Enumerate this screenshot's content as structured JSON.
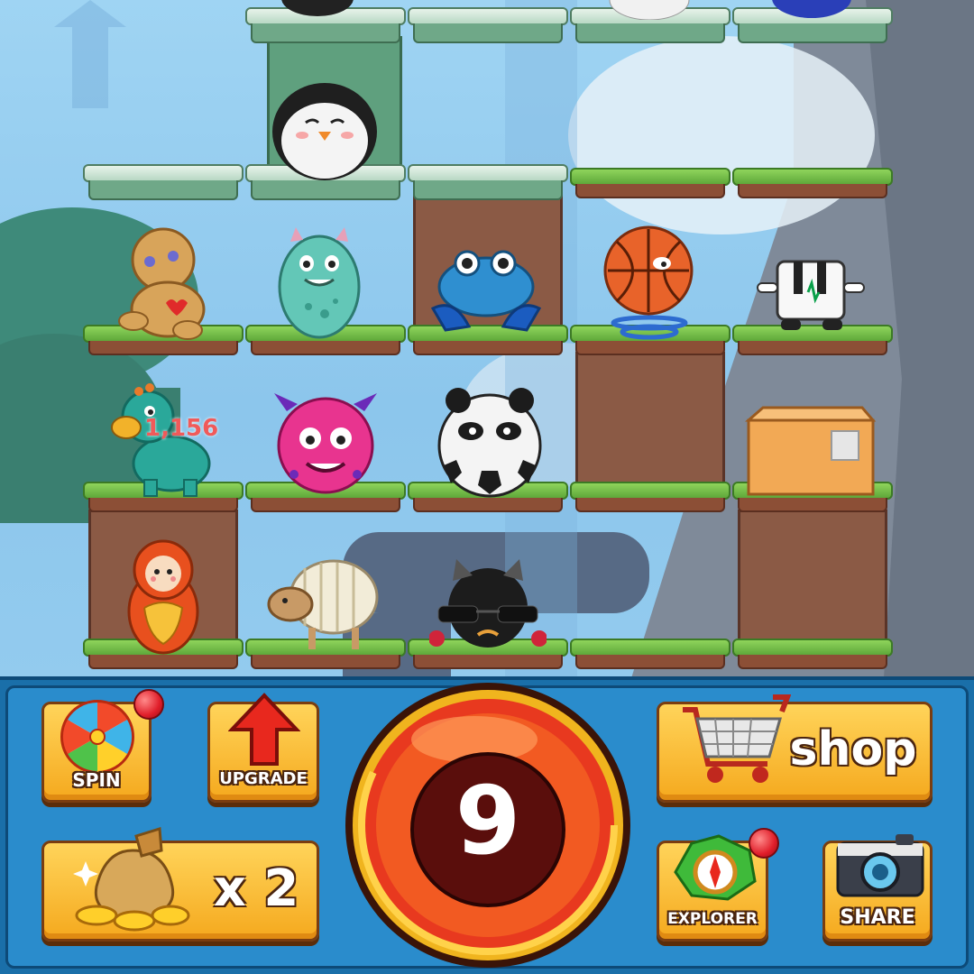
{
  "board": {
    "floating_coin_text": "1,156",
    "monsters": [
      {
        "name": "penguin",
        "row": "stone"
      },
      {
        "name": "voodoo-doll"
      },
      {
        "name": "teal-monster"
      },
      {
        "name": "blue-crab"
      },
      {
        "name": "basketball-spring"
      },
      {
        "name": "piano-cube"
      },
      {
        "name": "teal-dino"
      },
      {
        "name": "pink-fluffy-monster"
      },
      {
        "name": "panda-soccer-ball"
      },
      {
        "name": "cardboard-box"
      },
      {
        "name": "matryoshka-doll"
      },
      {
        "name": "woolly-sheep"
      },
      {
        "name": "bowling-ball-raccoon"
      }
    ]
  },
  "controls": {
    "spin": {
      "label": "SPIN",
      "icon": "wheel-icon",
      "has_notification": true
    },
    "upgrade": {
      "label": "UPGRADE",
      "icon": "up-arrow-icon"
    },
    "coins_multiplier": {
      "label": "x 2",
      "icon": "coin-bag-icon"
    },
    "counter": {
      "value": "9"
    },
    "shop": {
      "label": "shop",
      "icon": "shopping-cart-icon"
    },
    "explorer": {
      "label": "EXPLORER",
      "icon": "compass-gem-icon",
      "has_notification": true
    },
    "share": {
      "label": "SHARE",
      "icon": "camera-icon"
    }
  },
  "colors": {
    "panel_blue": "#2a8ccc",
    "button_gold": "#f5a91e",
    "counter_ring": "#e8391f",
    "notification_red": "#e01e2a"
  }
}
